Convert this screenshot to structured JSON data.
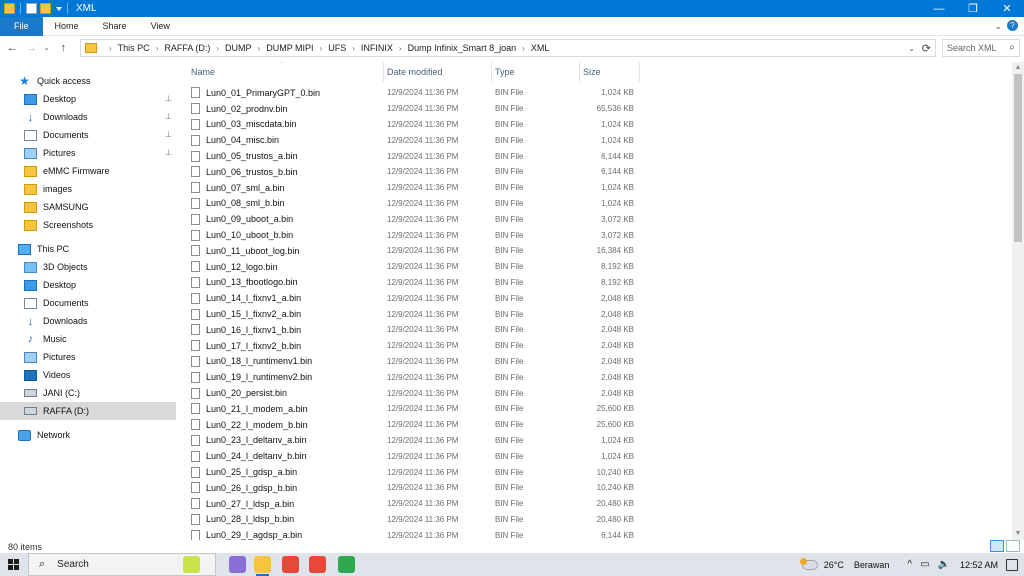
{
  "window": {
    "title": "XML",
    "controls": {
      "minimize": "—",
      "maximize": "❐",
      "close": "✕"
    }
  },
  "ribbon": {
    "tabs": [
      "File",
      "Home",
      "Share",
      "View"
    ],
    "expand_label": "⌄",
    "help_label": "?"
  },
  "address": {
    "crumbs": [
      "This PC",
      "RAFFA (D:)",
      "DUMP",
      "DUMP MIPI",
      "UFS",
      "INFINIX",
      "Dump Infinix_Smart 8_joan",
      "XML"
    ],
    "search_placeholder": "Search XML"
  },
  "nav": {
    "items": [
      {
        "label": "Quick access",
        "icon": "star-icon",
        "cls": "ic-star",
        "glyph": "★",
        "indent": 0,
        "pinned": false
      },
      {
        "label": "Desktop",
        "icon": "desktop-icon",
        "cls": "ic-desk",
        "glyph": "",
        "indent": 1,
        "pinned": true
      },
      {
        "label": "Downloads",
        "icon": "download-icon",
        "cls": "ic-down",
        "glyph": "↓",
        "indent": 1,
        "pinned": true
      },
      {
        "label": "Documents",
        "icon": "document-icon",
        "cls": "ic-doc",
        "glyph": "",
        "indent": 1,
        "pinned": true
      },
      {
        "label": "Pictures",
        "icon": "pictures-icon",
        "cls": "ic-pic",
        "glyph": "",
        "indent": 1,
        "pinned": true
      },
      {
        "label": "eMMC Firmware",
        "icon": "folder-icon",
        "cls": "ic-fold",
        "glyph": "",
        "indent": 1,
        "pinned": false
      },
      {
        "label": "images",
        "icon": "folder-icon",
        "cls": "ic-fold",
        "glyph": "",
        "indent": 1,
        "pinned": false
      },
      {
        "label": "SAMSUNG",
        "icon": "folder-icon",
        "cls": "ic-fold",
        "glyph": "",
        "indent": 1,
        "pinned": false
      },
      {
        "label": "Screenshots",
        "icon": "folder-icon",
        "cls": "ic-fold",
        "glyph": "",
        "indent": 1,
        "pinned": false
      },
      {
        "label": "This PC",
        "icon": "computer-icon",
        "cls": "ic-pc",
        "glyph": "",
        "indent": 0,
        "pinned": false
      },
      {
        "label": "3D Objects",
        "icon": "3d-objects-icon",
        "cls": "ic-3d",
        "glyph": "",
        "indent": 1,
        "pinned": false
      },
      {
        "label": "Desktop",
        "icon": "desktop-icon",
        "cls": "ic-desk",
        "glyph": "",
        "indent": 1,
        "pinned": false
      },
      {
        "label": "Documents",
        "icon": "document-icon",
        "cls": "ic-doc",
        "glyph": "",
        "indent": 1,
        "pinned": false
      },
      {
        "label": "Downloads",
        "icon": "download-icon",
        "cls": "ic-down",
        "glyph": "↓",
        "indent": 1,
        "pinned": false
      },
      {
        "label": "Music",
        "icon": "music-icon",
        "cls": "ic-music",
        "glyph": "♪",
        "indent": 1,
        "pinned": false
      },
      {
        "label": "Pictures",
        "icon": "pictures-icon",
        "cls": "ic-pic",
        "glyph": "",
        "indent": 1,
        "pinned": false
      },
      {
        "label": "Videos",
        "icon": "video-icon",
        "cls": "ic-video",
        "glyph": "",
        "indent": 1,
        "pinned": false
      },
      {
        "label": "JANI (C:)",
        "icon": "drive-icon",
        "cls": "ic-drive",
        "glyph": "",
        "indent": 1,
        "pinned": false
      },
      {
        "label": "RAFFA (D:)",
        "icon": "drive-icon",
        "cls": "ic-drive",
        "glyph": "",
        "indent": 1,
        "pinned": false,
        "selected": true
      },
      {
        "label": "Network",
        "icon": "network-icon",
        "cls": "ic-net",
        "glyph": "",
        "indent": 0,
        "pinned": false
      }
    ],
    "pin_glyph": "📌"
  },
  "columns": [
    "Name",
    "Date modified",
    "Type",
    "Size"
  ],
  "files": [
    {
      "name": "Lun0_01_PrimaryGPT_0.bin",
      "date": "12/9/2024 11:36 PM",
      "type": "BIN File",
      "size": "1,024 KB"
    },
    {
      "name": "Lun0_02_prodnv.bin",
      "date": "12/9/2024 11:36 PM",
      "type": "BIN File",
      "size": "65,536 KB"
    },
    {
      "name": "Lun0_03_miscdata.bin",
      "date": "12/9/2024 11:36 PM",
      "type": "BIN File",
      "size": "1,024 KB"
    },
    {
      "name": "Lun0_04_misc.bin",
      "date": "12/9/2024 11:36 PM",
      "type": "BIN File",
      "size": "1,024 KB"
    },
    {
      "name": "Lun0_05_trustos_a.bin",
      "date": "12/9/2024 11:36 PM",
      "type": "BIN File",
      "size": "6,144 KB"
    },
    {
      "name": "Lun0_06_trustos_b.bin",
      "date": "12/9/2024 11:36 PM",
      "type": "BIN File",
      "size": "6,144 KB"
    },
    {
      "name": "Lun0_07_sml_a.bin",
      "date": "12/9/2024 11:36 PM",
      "type": "BIN File",
      "size": "1,024 KB"
    },
    {
      "name": "Lun0_08_sml_b.bin",
      "date": "12/9/2024 11:36 PM",
      "type": "BIN File",
      "size": "1,024 KB"
    },
    {
      "name": "Lun0_09_uboot_a.bin",
      "date": "12/9/2024 11:36 PM",
      "type": "BIN File",
      "size": "3,072 KB"
    },
    {
      "name": "Lun0_10_uboot_b.bin",
      "date": "12/9/2024 11:36 PM",
      "type": "BIN File",
      "size": "3,072 KB"
    },
    {
      "name": "Lun0_11_uboot_log.bin",
      "date": "12/9/2024 11:36 PM",
      "type": "BIN File",
      "size": "16,384 KB"
    },
    {
      "name": "Lun0_12_logo.bin",
      "date": "12/9/2024 11:36 PM",
      "type": "BIN File",
      "size": "8,192 KB"
    },
    {
      "name": "Lun0_13_fbootlogo.bin",
      "date": "12/9/2024 11:36 PM",
      "type": "BIN File",
      "size": "8,192 KB"
    },
    {
      "name": "Lun0_14_l_fixnv1_a.bin",
      "date": "12/9/2024 11:36 PM",
      "type": "BIN File",
      "size": "2,048 KB"
    },
    {
      "name": "Lun0_15_l_fixnv2_a.bin",
      "date": "12/9/2024 11:36 PM",
      "type": "BIN File",
      "size": "2,048 KB"
    },
    {
      "name": "Lun0_16_l_fixnv1_b.bin",
      "date": "12/9/2024 11:36 PM",
      "type": "BIN File",
      "size": "2,048 KB"
    },
    {
      "name": "Lun0_17_l_fixnv2_b.bin",
      "date": "12/9/2024 11:36 PM",
      "type": "BIN File",
      "size": "2,048 KB"
    },
    {
      "name": "Lun0_18_l_runtimenv1.bin",
      "date": "12/9/2024 11:36 PM",
      "type": "BIN File",
      "size": "2,048 KB"
    },
    {
      "name": "Lun0_19_l_runtimenv2.bin",
      "date": "12/9/2024 11:36 PM",
      "type": "BIN File",
      "size": "2,048 KB"
    },
    {
      "name": "Lun0_20_persist.bin",
      "date": "12/9/2024 11:36 PM",
      "type": "BIN File",
      "size": "2,048 KB"
    },
    {
      "name": "Lun0_21_l_modem_a.bin",
      "date": "12/9/2024 11:36 PM",
      "type": "BIN File",
      "size": "25,600 KB"
    },
    {
      "name": "Lun0_22_l_modem_b.bin",
      "date": "12/9/2024 11:36 PM",
      "type": "BIN File",
      "size": "25,600 KB"
    },
    {
      "name": "Lun0_23_l_deltanv_a.bin",
      "date": "12/9/2024 11:36 PM",
      "type": "BIN File",
      "size": "1,024 KB"
    },
    {
      "name": "Lun0_24_l_deltanv_b.bin",
      "date": "12/9/2024 11:36 PM",
      "type": "BIN File",
      "size": "1,024 KB"
    },
    {
      "name": "Lun0_25_l_gdsp_a.bin",
      "date": "12/9/2024 11:36 PM",
      "type": "BIN File",
      "size": "10,240 KB"
    },
    {
      "name": "Lun0_26_l_gdsp_b.bin",
      "date": "12/9/2024 11:36 PM",
      "type": "BIN File",
      "size": "10,240 KB"
    },
    {
      "name": "Lun0_27_l_ldsp_a.bin",
      "date": "12/9/2024 11:36 PM",
      "type": "BIN File",
      "size": "20,480 KB"
    },
    {
      "name": "Lun0_28_l_ldsp_b.bin",
      "date": "12/9/2024 11:36 PM",
      "type": "BIN File",
      "size": "20,480 KB"
    },
    {
      "name": "Lun0_29_l_agdsp_a.bin",
      "date": "12/9/2024 11:36 PM",
      "type": "BIN File",
      "size": "6,144 KB"
    }
  ],
  "status": {
    "item_count": "80 items"
  },
  "taskbar": {
    "search_label": "Search",
    "apps": [
      {
        "name": "tennis-widget-icon",
        "color": "#c9e34a"
      },
      {
        "name": "color-app-icon",
        "color": "#8a6fd6"
      },
      {
        "name": "file-explorer-icon",
        "color": "#f5c542",
        "active": true
      },
      {
        "name": "chrome-icon",
        "color": "#e8483a"
      },
      {
        "name": "chrome-icon-2",
        "color": "#e8483a"
      },
      {
        "name": "green-app-icon",
        "color": "#2fa84f"
      }
    ],
    "weather_temp": "26°C",
    "weather_text": "Berawan",
    "tray_up": "^",
    "time": "12:52 AM"
  },
  "colors": {
    "titlebar": "#0078d7",
    "file_tab": "#1979ca",
    "selected_nav": "#d9d9d9"
  }
}
